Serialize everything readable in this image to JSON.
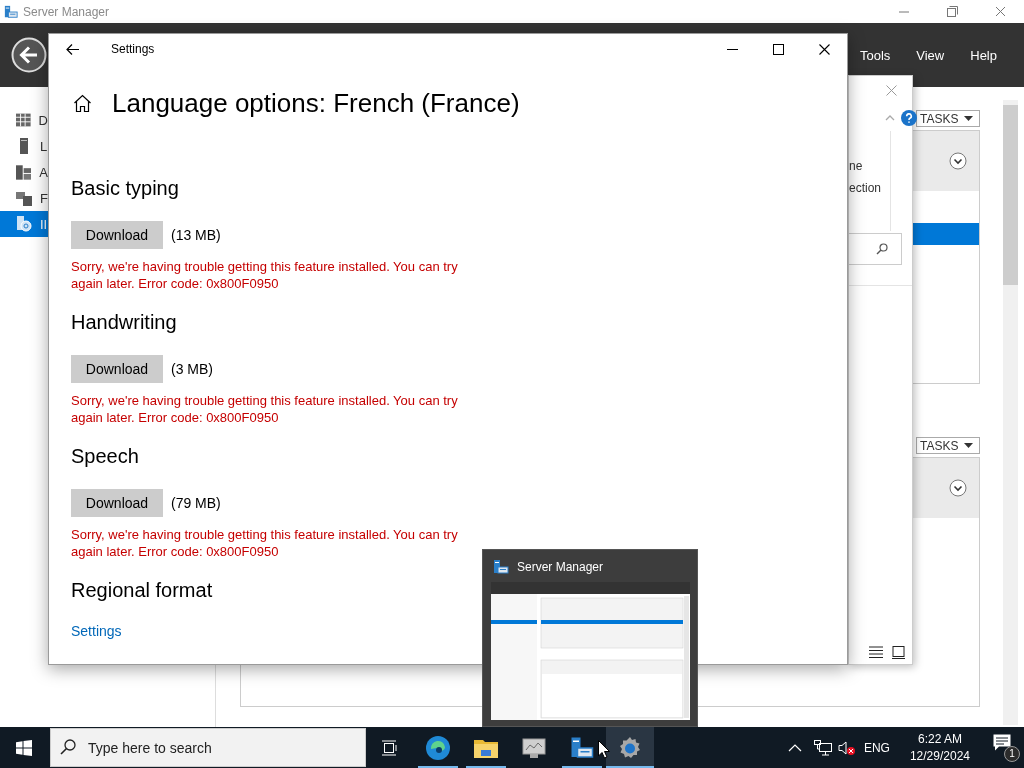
{
  "server_manager": {
    "title": "Server Manager",
    "menu": [
      "Tools",
      "View",
      "Help"
    ],
    "nav_items": [
      {
        "label": "D",
        "selected": false
      },
      {
        "label": "L",
        "selected": false
      },
      {
        "label": "A",
        "selected": false
      },
      {
        "label": "F",
        "selected": false
      },
      {
        "label": "II",
        "selected": true
      }
    ],
    "panels": [
      {
        "tasks": "TASKS",
        "highlight_row": true
      },
      {
        "tasks": "TASKS"
      }
    ]
  },
  "dialog": {
    "lines": [
      "ne",
      "ection"
    ]
  },
  "settings": {
    "title": "Settings",
    "heading": "Language options: French (France)",
    "sections": [
      {
        "kind": "download",
        "title": "Basic typing",
        "button": "Download",
        "size": "(13 MB)",
        "error": "Sorry, we're having trouble getting this feature installed. You can try again later. Error code: 0x800F0950"
      },
      {
        "kind": "download",
        "title": "Handwriting",
        "button": "Download",
        "size": "(3 MB)",
        "error": "Sorry, we're having trouble getting this feature installed. You can try again later. Error code: 0x800F0950"
      },
      {
        "kind": "download",
        "title": "Speech",
        "button": "Download",
        "size": "(79 MB)",
        "error": "Sorry, we're having trouble getting this feature installed. You can try again later. Error code: 0x800F0950"
      },
      {
        "kind": "link",
        "title": "Regional format",
        "link": "Settings"
      }
    ]
  },
  "thumbnail": {
    "title": "Server Manager"
  },
  "taskbar": {
    "search": {
      "placeholder": "Type here to search"
    },
    "apps": [
      {
        "kind": "task-view",
        "running": false,
        "active": false
      },
      {
        "kind": "browser",
        "running": true,
        "active": false
      },
      {
        "kind": "folder",
        "running": true,
        "active": false
      },
      {
        "kind": "monitor",
        "running": false,
        "active": false
      },
      {
        "kind": "server-manager",
        "running": true,
        "active": false
      },
      {
        "kind": "settings",
        "running": true,
        "active": true
      }
    ],
    "language": "ENG",
    "time": "6:22 AM",
    "date": "12/29/2024",
    "notifications": "1"
  }
}
